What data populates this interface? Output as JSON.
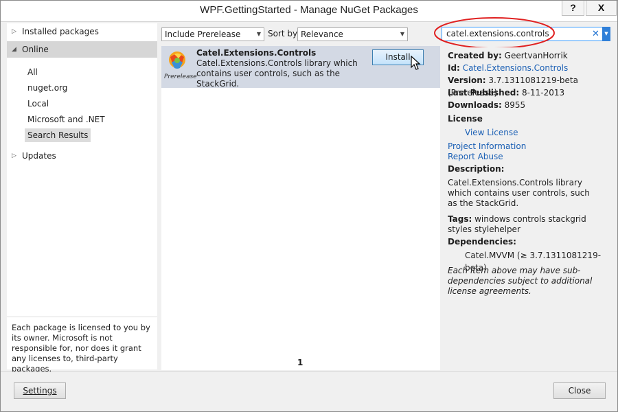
{
  "window": {
    "title": "WPF.GettingStarted - Manage NuGet Packages",
    "help_label": "?",
    "close_label": "X"
  },
  "sidebar": {
    "installed_label": "Installed packages",
    "online_label": "Online",
    "online_items": [
      "All",
      "nuget.org",
      "Local",
      "Microsoft and .NET",
      "Search Results"
    ],
    "selected_item": "Search Results",
    "updates_label": "Updates",
    "license_note": "Each package is licensed to you by its owner. Microsoft is not responsible for, nor does it grant any licenses to, third-party packages."
  },
  "toolbar": {
    "prerelease_value": "Include Prerelease",
    "sort_label": "Sort by:",
    "sort_value": "Relevance"
  },
  "search": {
    "value": "catel.extensions.controls",
    "clear_icon": "close-icon",
    "dropdown_icon": "chevron-down-icon"
  },
  "results": {
    "packages": [
      {
        "name": "Catel.Extensions.Controls",
        "description": "Catel.Extensions.Controls library which contains user controls, such as the StackGrid.",
        "tag": "Prerelease",
        "action": "Install"
      }
    ],
    "page": "1"
  },
  "details": {
    "created_by_label": "Created by:",
    "created_by": "GeertvanHorrik",
    "id_label": "Id:",
    "id": "Catel.Extensions.Controls",
    "version_label": "Version:",
    "version": "3.7.1311081219-beta (Prerelease)",
    "published_label": "Last Published:",
    "published": "8-11-2013",
    "downloads_label": "Downloads:",
    "downloads": "8955",
    "license_label": "License",
    "view_license": "View License",
    "project_info": "Project Information",
    "report_abuse": "Report Abuse",
    "description_label": "Description:",
    "description": "Catel.Extensions.Controls library which contains user controls, such as the StackGrid.",
    "tags_label": "Tags:",
    "tags": "windows controls stackgrid styles stylehelper",
    "dependencies_label": "Dependencies:",
    "dependency": "Catel.MVVM (≥ 3.7.1311081219-beta)",
    "dependency_note": "Each item above may have sub-dependencies subject to additional license agreements."
  },
  "footer": {
    "settings_label": "Settings",
    "close_label": "Close"
  },
  "colors": {
    "accent": "#3399ff",
    "selection": "#d3d9e4",
    "annotation": "#e02020"
  }
}
